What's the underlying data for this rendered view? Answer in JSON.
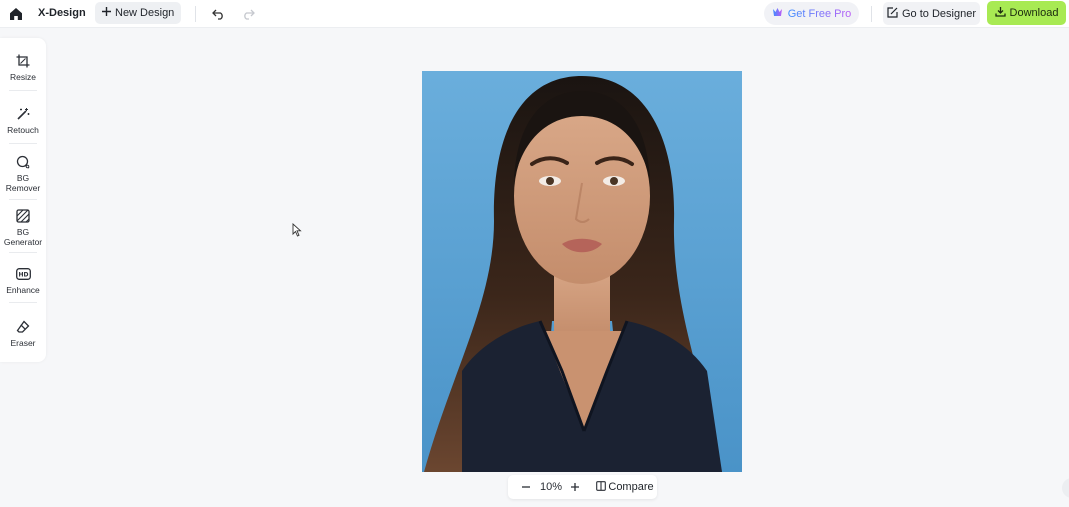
{
  "header": {
    "home_icon": "home-icon",
    "app_title": "X-Design",
    "new_design_label": "New Design",
    "get_pro_label": "Get Free Pro",
    "go_designer_label": "Go to Designer",
    "download_label": "Download",
    "accent_color": "#a8ea53"
  },
  "sidebar": {
    "items": [
      {
        "label": "Resize",
        "icon": "crop-icon"
      },
      {
        "label": "Retouch",
        "icon": "magic-wand-icon"
      },
      {
        "label": "BG Remover",
        "icon": "bg-remover-icon"
      },
      {
        "label": "BG Generator",
        "icon": "bg-generator-icon"
      },
      {
        "label": "Enhance",
        "icon": "hd-icon"
      },
      {
        "label": "Eraser",
        "icon": "eraser-icon"
      }
    ]
  },
  "canvas": {
    "image_alt": "Portrait photo"
  },
  "zoom": {
    "level": "10%",
    "compare_label": "Compare"
  }
}
